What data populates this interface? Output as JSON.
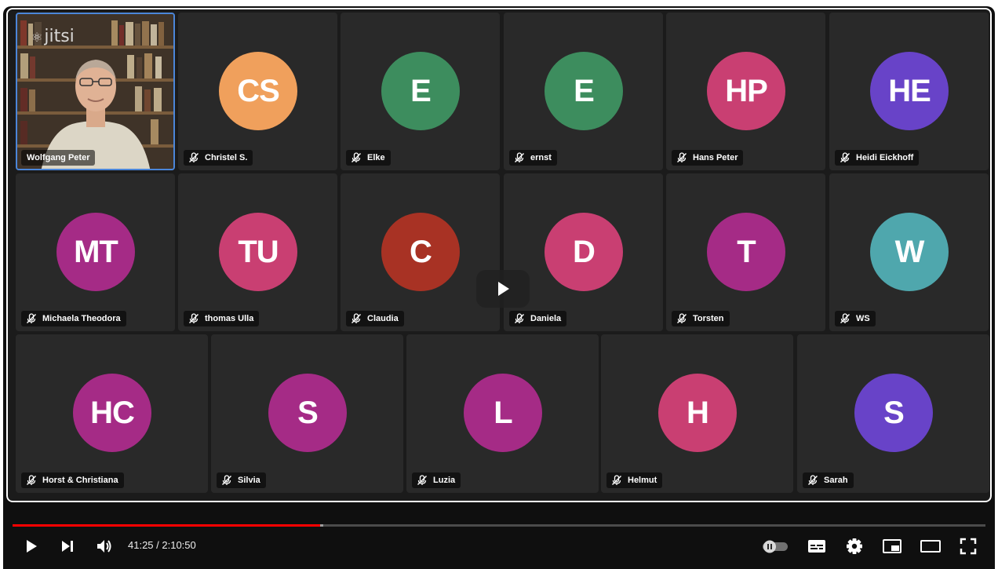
{
  "participants_row1": [
    {
      "initials": "CS",
      "name": "Christel S.",
      "color": "#f0a05c"
    },
    {
      "initials": "E",
      "name": "Elke",
      "color": "#3d8d5e"
    },
    {
      "initials": "E",
      "name": "ernst",
      "color": "#3d8d5e"
    },
    {
      "initials": "HP",
      "name": "Hans Peter",
      "color": "#c93f72"
    },
    {
      "initials": "HE",
      "name": "Heidi Eickhoff",
      "color": "#6843c8"
    }
  ],
  "participants_row2": [
    {
      "initials": "MT",
      "name": "Michaela Theodora",
      "color": "#a52b86"
    },
    {
      "initials": "TU",
      "name": "thomas Ulla",
      "color": "#c93f72"
    },
    {
      "initials": "C",
      "name": "Claudia",
      "color": "#a83224"
    },
    {
      "initials": "D",
      "name": "Daniela",
      "color": "#c93f72"
    },
    {
      "initials": "T",
      "name": "Torsten",
      "color": "#a52b86"
    },
    {
      "initials": "W",
      "name": "WS",
      "color": "#4fa7ad"
    }
  ],
  "participants_row3": [
    {
      "initials": "HC",
      "name": "Horst & Christiana",
      "color": "#a52b86"
    },
    {
      "initials": "S",
      "name": "Silvia",
      "color": "#a52b86"
    },
    {
      "initials": "L",
      "name": "Luzia",
      "color": "#a52b86"
    },
    {
      "initials": "H",
      "name": "Helmut",
      "color": "#c93f72"
    },
    {
      "initials": "S",
      "name": "Sarah",
      "color": "#6843c8"
    }
  ],
  "self_view": {
    "name": "Wolfgang Peter",
    "watermark": "jitsi"
  },
  "player": {
    "current_time": "41:25",
    "duration": "2:10:50",
    "time_display": "41:25 / 2:10:50",
    "progress": 0.316,
    "buffered": 0.319,
    "accent_color": "#ff0000"
  },
  "controls": {
    "play": "play-icon",
    "next": "next-icon",
    "volume": "volume-icon",
    "autoplay": "autoplay-toggle",
    "subtitles": "subtitles-icon",
    "settings": "gear-icon",
    "miniplayer": "miniplayer-icon",
    "theater": "theater-icon",
    "fullscreen": "fullscreen-icon"
  }
}
